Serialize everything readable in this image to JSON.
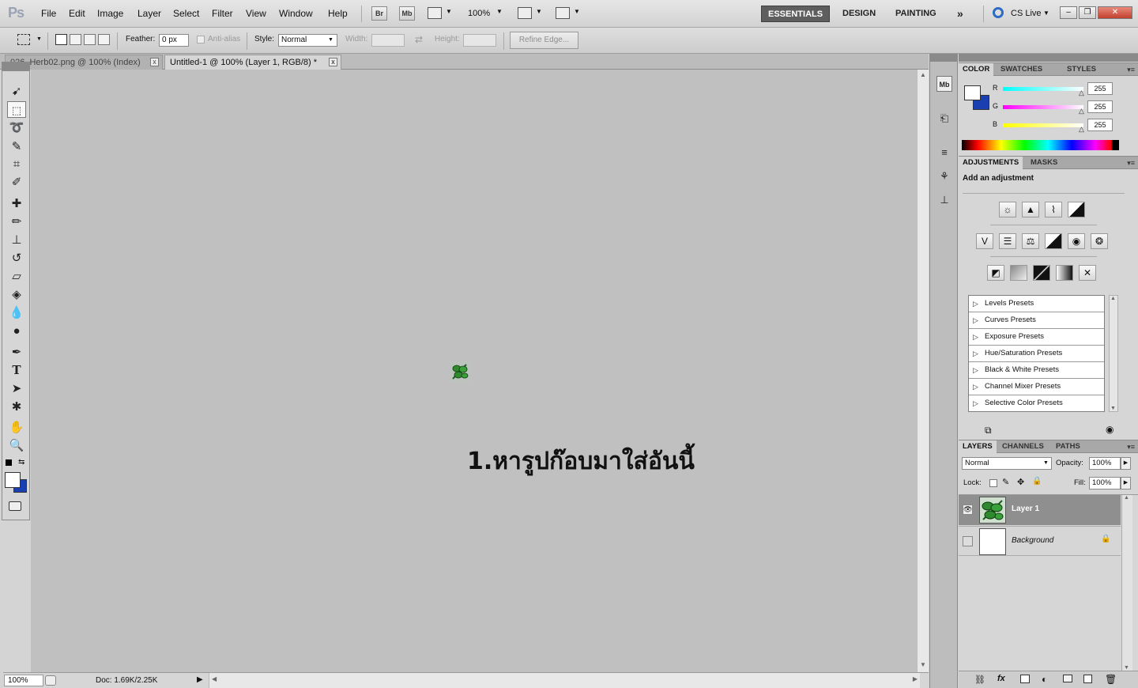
{
  "app": {
    "logo": "Ps"
  },
  "menu": [
    "File",
    "Edit",
    "Image",
    "Layer",
    "Select",
    "Filter",
    "View",
    "Window",
    "Help"
  ],
  "appbar": {
    "bridge": "Br",
    "minibridge": "Mb",
    "zoom": "100%"
  },
  "workspaces": [
    "ESSENTIALS",
    "DESIGN",
    "PAINTING"
  ],
  "workspace_more": "»",
  "cs_live": "CS Live",
  "window_controls": {
    "minimize": "–",
    "restore": "❐",
    "close": "✕"
  },
  "options": {
    "feather_label": "Feather:",
    "feather_value": "0 px",
    "antialias_label": "Anti-alias",
    "style_label": "Style:",
    "style_value": "Normal",
    "width_label": "Width:",
    "height_label": "Height:",
    "refine_edge": "Refine Edge..."
  },
  "tabs": [
    {
      "label": "026_Herb02.png @ 100% (Index)",
      "close": "x"
    },
    {
      "label": "Untitled-1 @ 100% (Layer 1, RGB/8) *",
      "close": "x"
    }
  ],
  "canvas": {
    "overlay_text": "1.หารูปก๊อบมาใส่อันนี้"
  },
  "status": {
    "zoom": "100%",
    "doc": "Doc: 1.69K/2.25K"
  },
  "color_panel": {
    "tabs": [
      "COLOR",
      "SWATCHES",
      "STYLES"
    ],
    "channels": [
      {
        "label": "R",
        "value": "255",
        "color": "#38e0e0"
      },
      {
        "label": "G",
        "value": "255",
        "color": "#e838e8"
      },
      {
        "label": "B",
        "value": "255",
        "color": "#e8e838"
      }
    ]
  },
  "adjustments": {
    "tabs": [
      "ADJUSTMENTS",
      "MASKS"
    ],
    "heading": "Add an adjustment",
    "presets": [
      "Levels Presets",
      "Curves Presets",
      "Exposure Presets",
      "Hue/Saturation Presets",
      "Black & White Presets",
      "Channel Mixer Presets",
      "Selective Color Presets"
    ]
  },
  "layers_panel": {
    "tabs": [
      "LAYERS",
      "CHANNELS",
      "PATHS"
    ],
    "blend_mode": "Normal",
    "opacity_label": "Opacity:",
    "opacity_value": "100%",
    "lock_label": "Lock:",
    "fill_label": "Fill:",
    "fill_value": "100%",
    "layers": [
      {
        "name": "Layer 1",
        "visible": true,
        "selected": true
      },
      {
        "name": "Background",
        "visible": false,
        "locked": true
      }
    ],
    "footer_icons": [
      "link-icon",
      "fx-icon",
      "mask-icon",
      "adjustment-icon",
      "group-icon",
      "new-layer-icon",
      "trash-icon"
    ]
  },
  "colors": {
    "accent_blue": "#1a3fb0",
    "canvas": "#c0c0c0",
    "selected_layer": "#8f8f8f"
  }
}
